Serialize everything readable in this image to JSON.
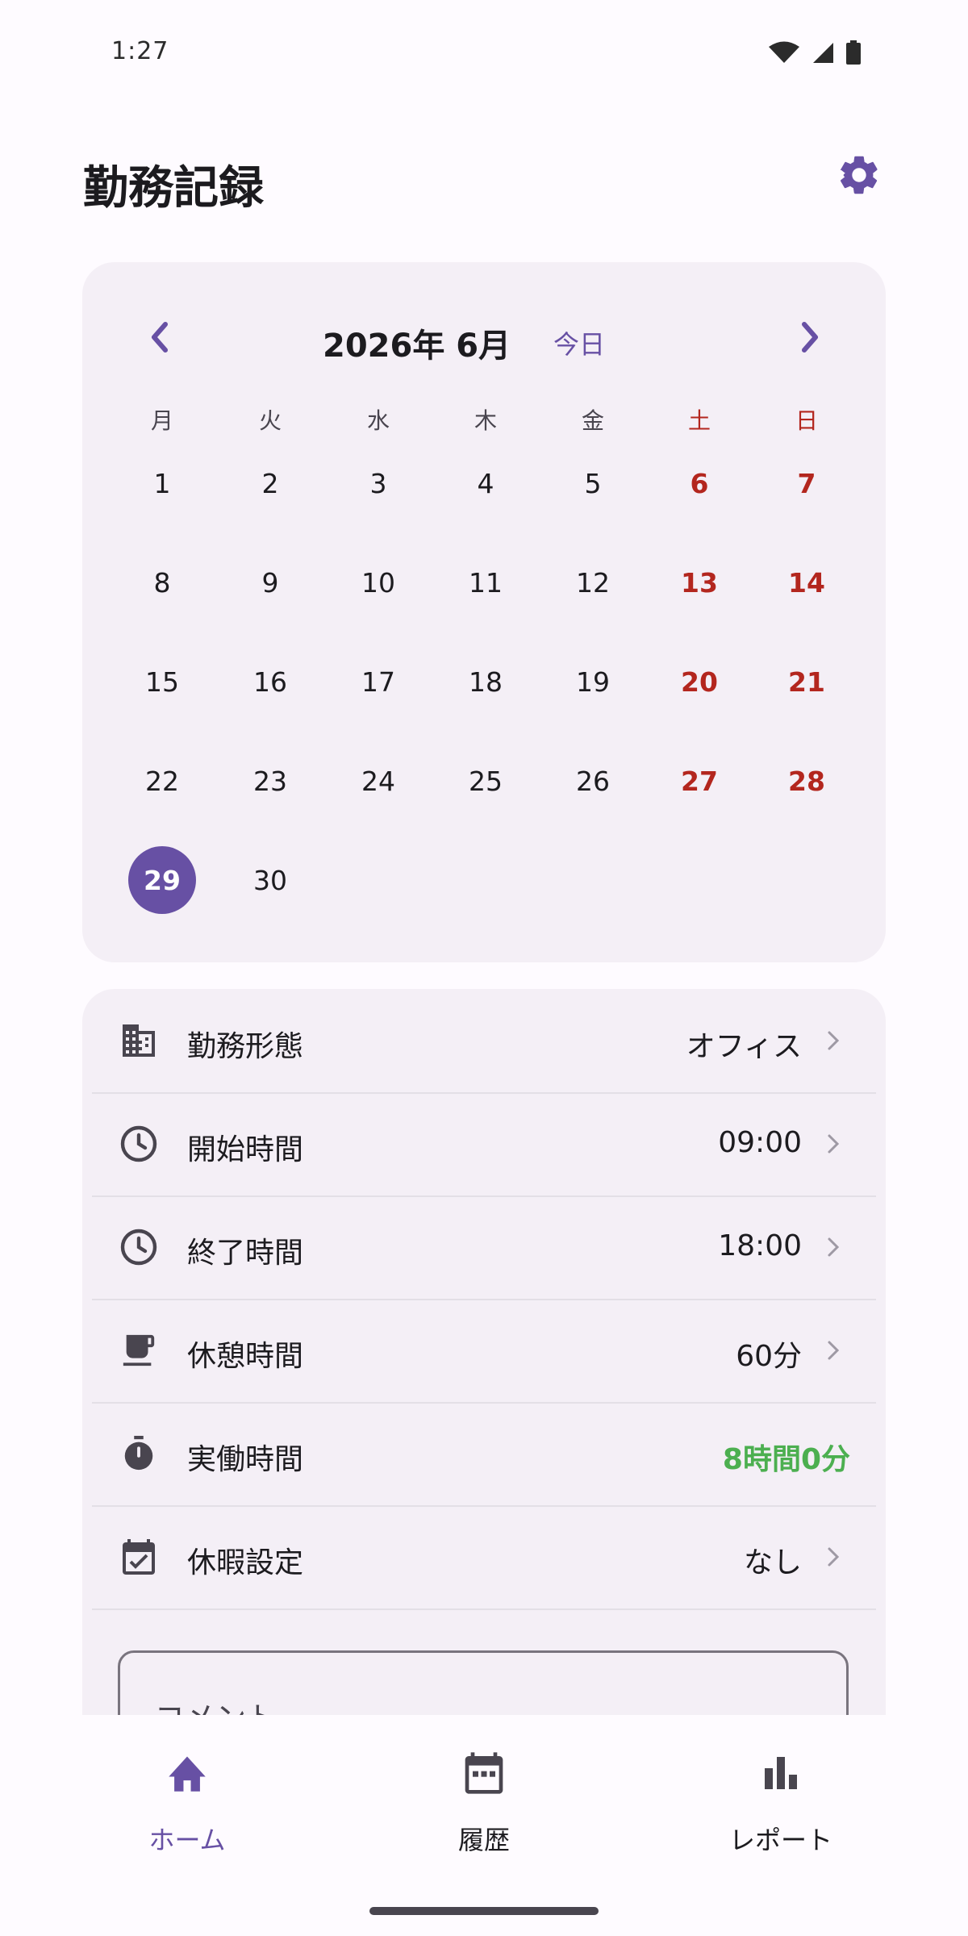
{
  "status_bar": {
    "time": "1:27"
  },
  "header": {
    "title": "勤務記録",
    "settings_icon": "gear-icon"
  },
  "calendar": {
    "month_label": "2026年 6月",
    "today_label": "今日",
    "weekdays": [
      "月",
      "火",
      "水",
      "木",
      "金",
      "土",
      "日"
    ],
    "weeks": [
      [
        "1",
        "2",
        "3",
        "4",
        "5",
        "6",
        "7"
      ],
      [
        "8",
        "9",
        "10",
        "11",
        "12",
        "13",
        "14"
      ],
      [
        "15",
        "16",
        "17",
        "18",
        "19",
        "20",
        "21"
      ],
      [
        "22",
        "23",
        "24",
        "25",
        "26",
        "27",
        "28"
      ],
      [
        "29",
        "30"
      ]
    ],
    "selected_day": "29"
  },
  "details": {
    "rows": [
      {
        "icon": "building-icon",
        "label": "勤務形態",
        "value": "オフィス"
      },
      {
        "icon": "clock-icon",
        "label": "開始時間",
        "value": "09:00"
      },
      {
        "icon": "clock-icon",
        "label": "終了時間",
        "value": "18:00"
      },
      {
        "icon": "coffee-icon",
        "label": "休憩時間",
        "value": "60分"
      },
      {
        "icon": "timer-icon",
        "label": "実働時間",
        "value": "8時間0分"
      },
      {
        "icon": "calendar-check-icon",
        "label": "休暇設定",
        "value": "なし"
      }
    ],
    "comment_label": "コメント"
  },
  "nav": {
    "items": [
      {
        "icon": "home-icon",
        "label": "ホーム"
      },
      {
        "icon": "calendar-icon",
        "label": "履歴"
      },
      {
        "icon": "bar-chart-icon",
        "label": "レポート"
      }
    ],
    "active_index": 0
  },
  "colors": {
    "accent": "#6750a4",
    "weekend": "#b3261e",
    "worktime": "#4caf50",
    "card": "#f4eff6"
  }
}
